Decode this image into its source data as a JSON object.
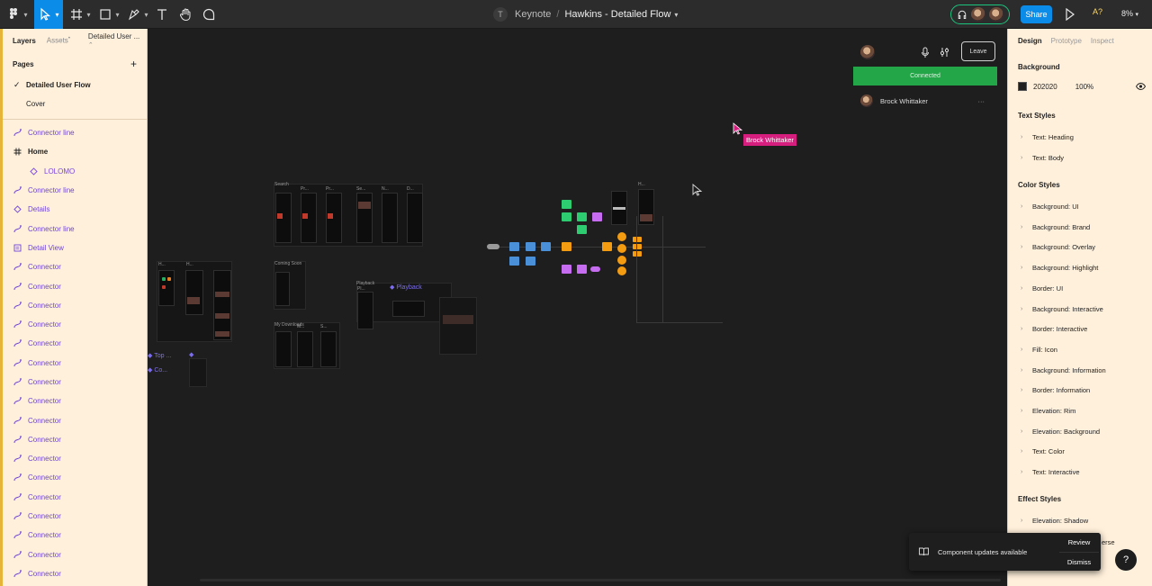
{
  "toolbar": {
    "project": "Keynote",
    "project_initial": "T",
    "separator": "/",
    "file_name": "Hawkins - Detailed Flow",
    "share_label": "Share",
    "ai_badge": "A?",
    "zoom": "8%"
  },
  "left_panel": {
    "tabs": {
      "layers": "Layers",
      "assets": "Assets",
      "page": "Detailed User ..."
    },
    "pages_title": "Pages",
    "add_page": "+",
    "pages": [
      {
        "label": "Detailed User Flow",
        "selected": true
      },
      {
        "label": "Cover",
        "selected": false
      }
    ],
    "layers": [
      {
        "label": "Connector line",
        "kind": "connector"
      },
      {
        "label": "Home",
        "kind": "frame"
      },
      {
        "label": "LOLOMO",
        "kind": "component"
      },
      {
        "label": "Connector line",
        "kind": "connector"
      },
      {
        "label": "Details",
        "kind": "instance"
      },
      {
        "label": "Connector line",
        "kind": "connector"
      },
      {
        "label": "Detail View",
        "kind": "section"
      },
      {
        "label": "Connector",
        "kind": "connector"
      },
      {
        "label": "Connector",
        "kind": "connector"
      },
      {
        "label": "Connector",
        "kind": "connector"
      },
      {
        "label": "Connector",
        "kind": "connector"
      },
      {
        "label": "Connector",
        "kind": "connector"
      },
      {
        "label": "Connector",
        "kind": "connector"
      },
      {
        "label": "Connector",
        "kind": "connector"
      },
      {
        "label": "Connector",
        "kind": "connector"
      },
      {
        "label": "Connector",
        "kind": "connector"
      },
      {
        "label": "Connector",
        "kind": "connector"
      },
      {
        "label": "Connector",
        "kind": "connector"
      },
      {
        "label": "Connector",
        "kind": "connector"
      },
      {
        "label": "Connector",
        "kind": "connector"
      },
      {
        "label": "Connector",
        "kind": "connector"
      },
      {
        "label": "Connector",
        "kind": "connector"
      },
      {
        "label": "Connector",
        "kind": "connector"
      },
      {
        "label": "Connector",
        "kind": "connector"
      }
    ]
  },
  "call_panel": {
    "leave_label": "Leave",
    "status": "Connected",
    "participant": "Brock Whittaker",
    "more": "···"
  },
  "cursor_tag": "Brock Whittaker",
  "canvas_labels": {
    "playback": "Playback",
    "top": "Top ...",
    "co": "Co...",
    "frames": [
      "Search",
      "Pr...",
      "Pr...",
      "Se...",
      "Se...",
      "N...",
      "D...",
      "H...",
      "H...",
      "Coming Soon",
      "My Downloads",
      "M...",
      "S...",
      "Playback",
      "Pl...",
      "H..."
    ]
  },
  "right_panel": {
    "tabs": {
      "design": "Design",
      "prototype": "Prototype",
      "inspect": "Inspect"
    },
    "background": {
      "title": "Background",
      "hex": "202020",
      "opacity": "100%",
      "color": "#202020"
    },
    "text_styles_title": "Text Styles",
    "text_styles": [
      "Text: Heading",
      "Text: Body"
    ],
    "color_styles_title": "Color Styles",
    "color_styles": [
      "Background: UI",
      "Background: Brand",
      "Background: Overlay",
      "Background: Highlight",
      "Border: UI",
      "Background: Interactive",
      "Border: Interactive",
      "Fill: Icon",
      "Background: Information",
      "Border: Information",
      "Elevation: Rim",
      "Elevation: Background",
      "Text: Color",
      "Text: Interactive"
    ],
    "effect_styles_title": "Effect Styles",
    "effect_styles": [
      "Elevation: Shadow"
    ],
    "partial_text": "erse"
  },
  "toast": {
    "message": "Component updates available",
    "review": "Review",
    "dismiss": "Dismiss"
  },
  "help": "?",
  "colors": {
    "accent": "#0c8ce9",
    "connected": "#23a647",
    "cursor": "#d61e7e",
    "panel_bg": "#fff0db",
    "layer_text": "#6e45d8"
  }
}
